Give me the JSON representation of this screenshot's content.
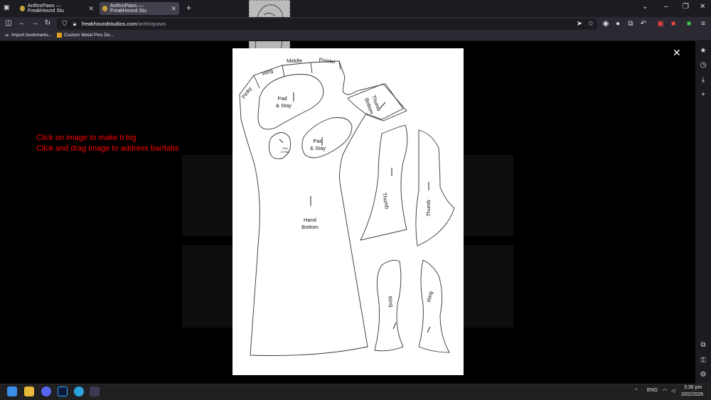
{
  "browser": {
    "tabs": [
      {
        "label": "AnthroPaws — FreakHound Stu"
      },
      {
        "label": "AnthroPaws — FreakHound Stu"
      }
    ],
    "url_host": "freakhoundstudios.com",
    "url_path": "/anthropaws",
    "bookmarks": [
      {
        "label": "Import bookmarks..."
      },
      {
        "label": "Custom Metal Pins De..."
      }
    ]
  },
  "page": {
    "hint_line1": "Click on image to make it big",
    "hint_line2": "Click and drag image to address bar/tabs"
  },
  "lightbox": {
    "labels": {
      "pinky": "Pinky",
      "ring_top": "Ring",
      "middle": "Middle",
      "pointer": "Pointer",
      "pad_stay_1a": "Pad",
      "pad_stay_1b": "& Stay",
      "pad_stay_2a": "Pad",
      "pad_stay_2b": "& Stay",
      "pad_stay_small_a": "Pad",
      "pad_stay_small_b": "& Stay",
      "thumb_bottom_a": "Thumb",
      "thumb_bottom_b": "Bottom",
      "hand_bottom_a": "Hand",
      "hand_bottom_b": "Bottom",
      "thumb_1": "Thumb",
      "thumb_2": "Thumb",
      "ring_1": "Ring",
      "ring_2": "Ring"
    }
  },
  "taskbar": {
    "lang": "ENG",
    "time": "3:36 pm",
    "date": "2/02/2026"
  },
  "colors": {
    "hint": "#ff0000",
    "tab_bg": "#1c1b22",
    "toolbar_bg": "#2b2a33"
  }
}
